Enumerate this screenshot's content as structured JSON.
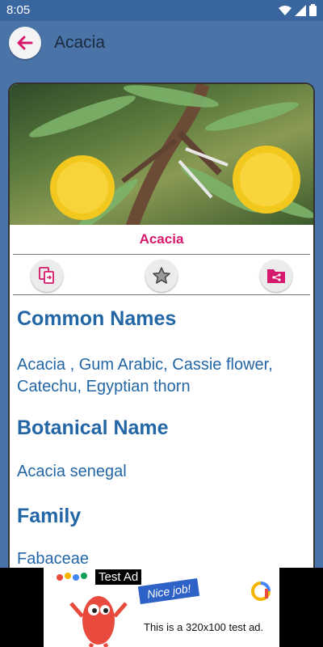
{
  "status_bar": {
    "time": "8:05"
  },
  "app_bar": {
    "title": "Acacia"
  },
  "plant": {
    "name": "Acacia",
    "image_alt_icon": "acacia-flower-photo"
  },
  "actions": [
    {
      "icon": "copy-icon"
    },
    {
      "icon": "star-icon"
    },
    {
      "icon": "share-folder-icon"
    }
  ],
  "sections": [
    {
      "heading": "Common Names",
      "text": "Acacia , Gum Arabic, Cassie flower, Catechu, Egyptian thorn"
    },
    {
      "heading": "Botanical Name",
      "text": "Acacia senegal"
    },
    {
      "heading": "Family",
      "text": "Fabaceae"
    }
  ],
  "ad": {
    "label": "Test Ad",
    "badge": "Nice job!",
    "text": "This is a 320x100 test ad."
  },
  "colors": {
    "primary": "#4a74a8",
    "accent": "#d6196c",
    "text_blue": "#2366a6"
  }
}
